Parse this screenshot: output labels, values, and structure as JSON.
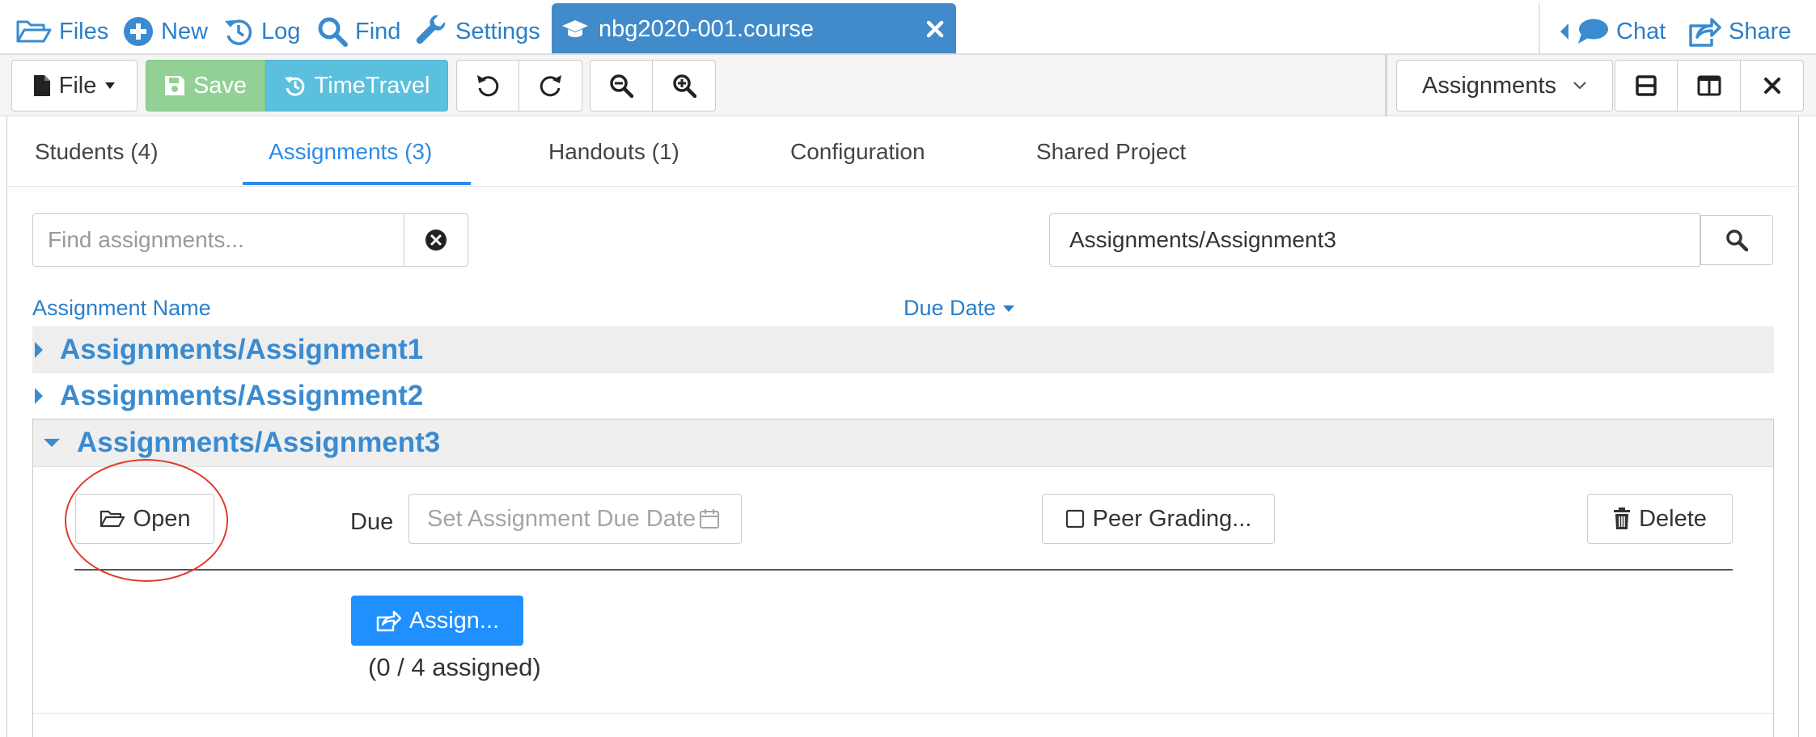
{
  "nav": {
    "files": "Files",
    "new": "New",
    "log": "Log",
    "find": "Find",
    "settings": "Settings",
    "active_tab": "nbg2020-001.course",
    "chat": "Chat",
    "share": "Share"
  },
  "toolbar": {
    "file": "File",
    "save": "Save",
    "timetravel": "TimeTravel",
    "frame_select": "Assignments"
  },
  "tabs": {
    "students": "Students (4)",
    "assignments": "Assignments (3)",
    "handouts": "Handouts (1)",
    "configuration": "Configuration",
    "shared_project": "Shared Project"
  },
  "search": {
    "placeholder": "Find assignments...",
    "path_value": "Assignments/Assignment3"
  },
  "list": {
    "col_name": "Assignment Name",
    "col_due": "Due Date",
    "rows": [
      {
        "name": "Assignments/Assignment1"
      },
      {
        "name": "Assignments/Assignment2"
      },
      {
        "name": "Assignments/Assignment3"
      }
    ]
  },
  "expanded": {
    "open": "Open",
    "due_label": "Due",
    "due_placeholder": "Set Assignment Due Date",
    "peer_grading": "Peer Grading...",
    "delete": "Delete",
    "assign": "Assign...",
    "assigned_status": "(0 / 4 assigned)"
  },
  "colors": {
    "link": "#2a7fc9",
    "active_tab_bg": "#428bca",
    "save_bg": "#93d095",
    "timetravel_bg": "#5bc0de",
    "assign_bg": "#1e90ff",
    "annotation": "#e03a2e"
  },
  "icons": {
    "files": "folder-open-icon",
    "new": "plus-circle-icon",
    "log": "history-icon",
    "find": "search-icon",
    "settings": "wrench-icon",
    "course": "graduation-cap-icon",
    "chat": "comment-icon",
    "share": "share-icon"
  }
}
